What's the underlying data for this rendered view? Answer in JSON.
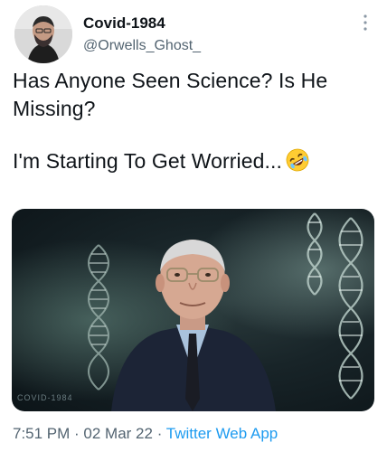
{
  "author": {
    "display_name": "Covid-1984",
    "handle": "@Orwells_Ghost_"
  },
  "tweet": {
    "line1": "Has Anyone Seen Science? Is He Missing?",
    "line2": "I'm Starting To Get Worried...",
    "emoji": "rolling-on-floor-laughing-emoji"
  },
  "media": {
    "watermark": "COVID-1984"
  },
  "meta": {
    "time": "7:51 PM",
    "sep1": " · ",
    "date": "02 Mar 22",
    "sep2": " · ",
    "source": "Twitter Web App"
  },
  "icons": {
    "more": "more-options-icon"
  }
}
